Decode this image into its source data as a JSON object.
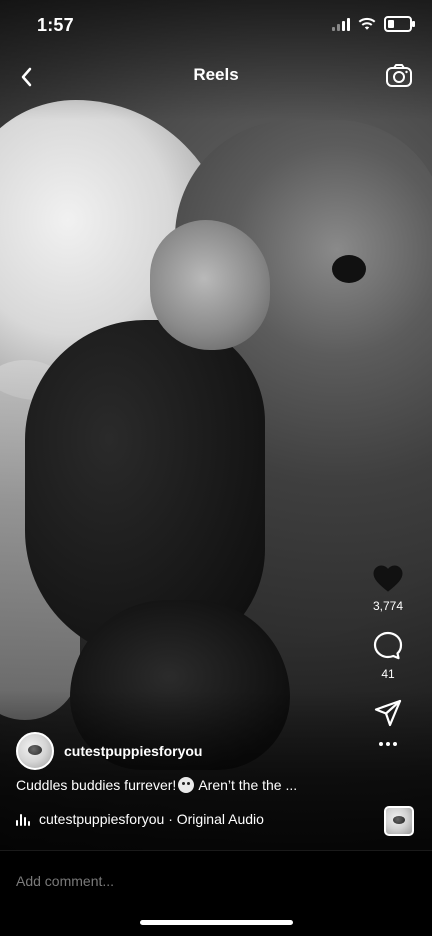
{
  "status_bar": {
    "time": "1:57"
  },
  "header": {
    "title": "Reels"
  },
  "actions": {
    "likes_count": "3,774",
    "comments_count": "41"
  },
  "post": {
    "username": "cutestpuppiesforyou",
    "caption_part1": "Cuddles buddies furrever!",
    "caption_part2": "Aren’t the the ..."
  },
  "audio": {
    "label": "cutestpuppiesforyou · Original Audio"
  },
  "comment_bar": {
    "placeholder": "Add comment..."
  },
  "icons": {
    "back": "chevron-left-icon",
    "camera": "camera-icon",
    "like": "heart-icon",
    "comment": "comment-bubble-icon",
    "share": "send-icon",
    "more": "more-horizontal-icon",
    "audio": "audio-bars-icon"
  },
  "colors": {
    "background": "#000000",
    "text": "#ffffff",
    "placeholder": "#7a7a7a"
  }
}
